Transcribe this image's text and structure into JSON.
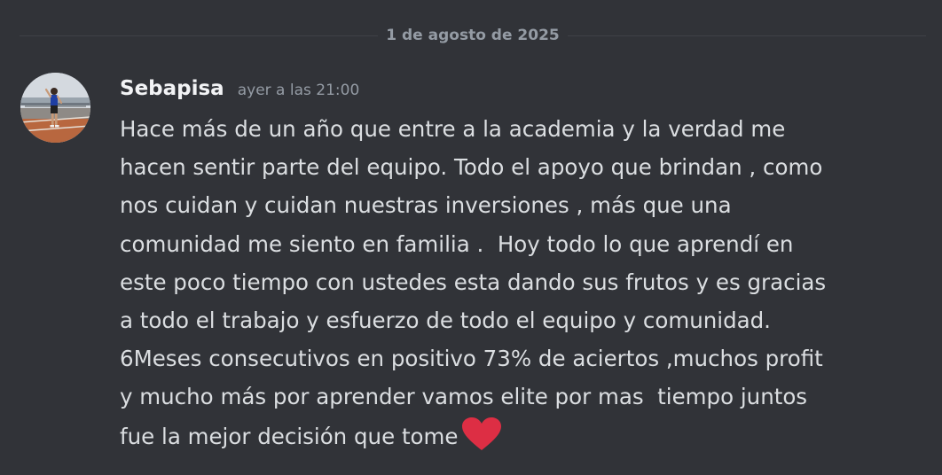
{
  "divider": {
    "date": "1 de agosto de 2025"
  },
  "message": {
    "author": "Sebapisa",
    "timestamp": "ayer a las 21:00",
    "lines": [
      "Hace más de un año que entre a la academia y la verdad me",
      "hacen sentir parte del equipo. Todo el apoyo que brindan , como",
      "nos cuidan y cuidan nuestras inversiones , más que una",
      "comunidad me siento en familia .  Hoy todo lo que aprendí en",
      "este poco tiempo con ustedes esta dando sus frutos y es gracias",
      "a todo el trabajo y esfuerzo de todo el equipo y comunidad.",
      "6Meses consecutivos en positivo 73% de aciertos ,muchos profit",
      "y mucho más por aprender vamos elite por mas  tiempo juntos",
      "fue la mejor decisión que tome"
    ],
    "emoji": "heart-icon"
  },
  "colors": {
    "background": "#313338",
    "text": "#dbdee1",
    "muted": "#949ba4",
    "username": "#f2f3f5",
    "heart": "#dd2e44"
  }
}
